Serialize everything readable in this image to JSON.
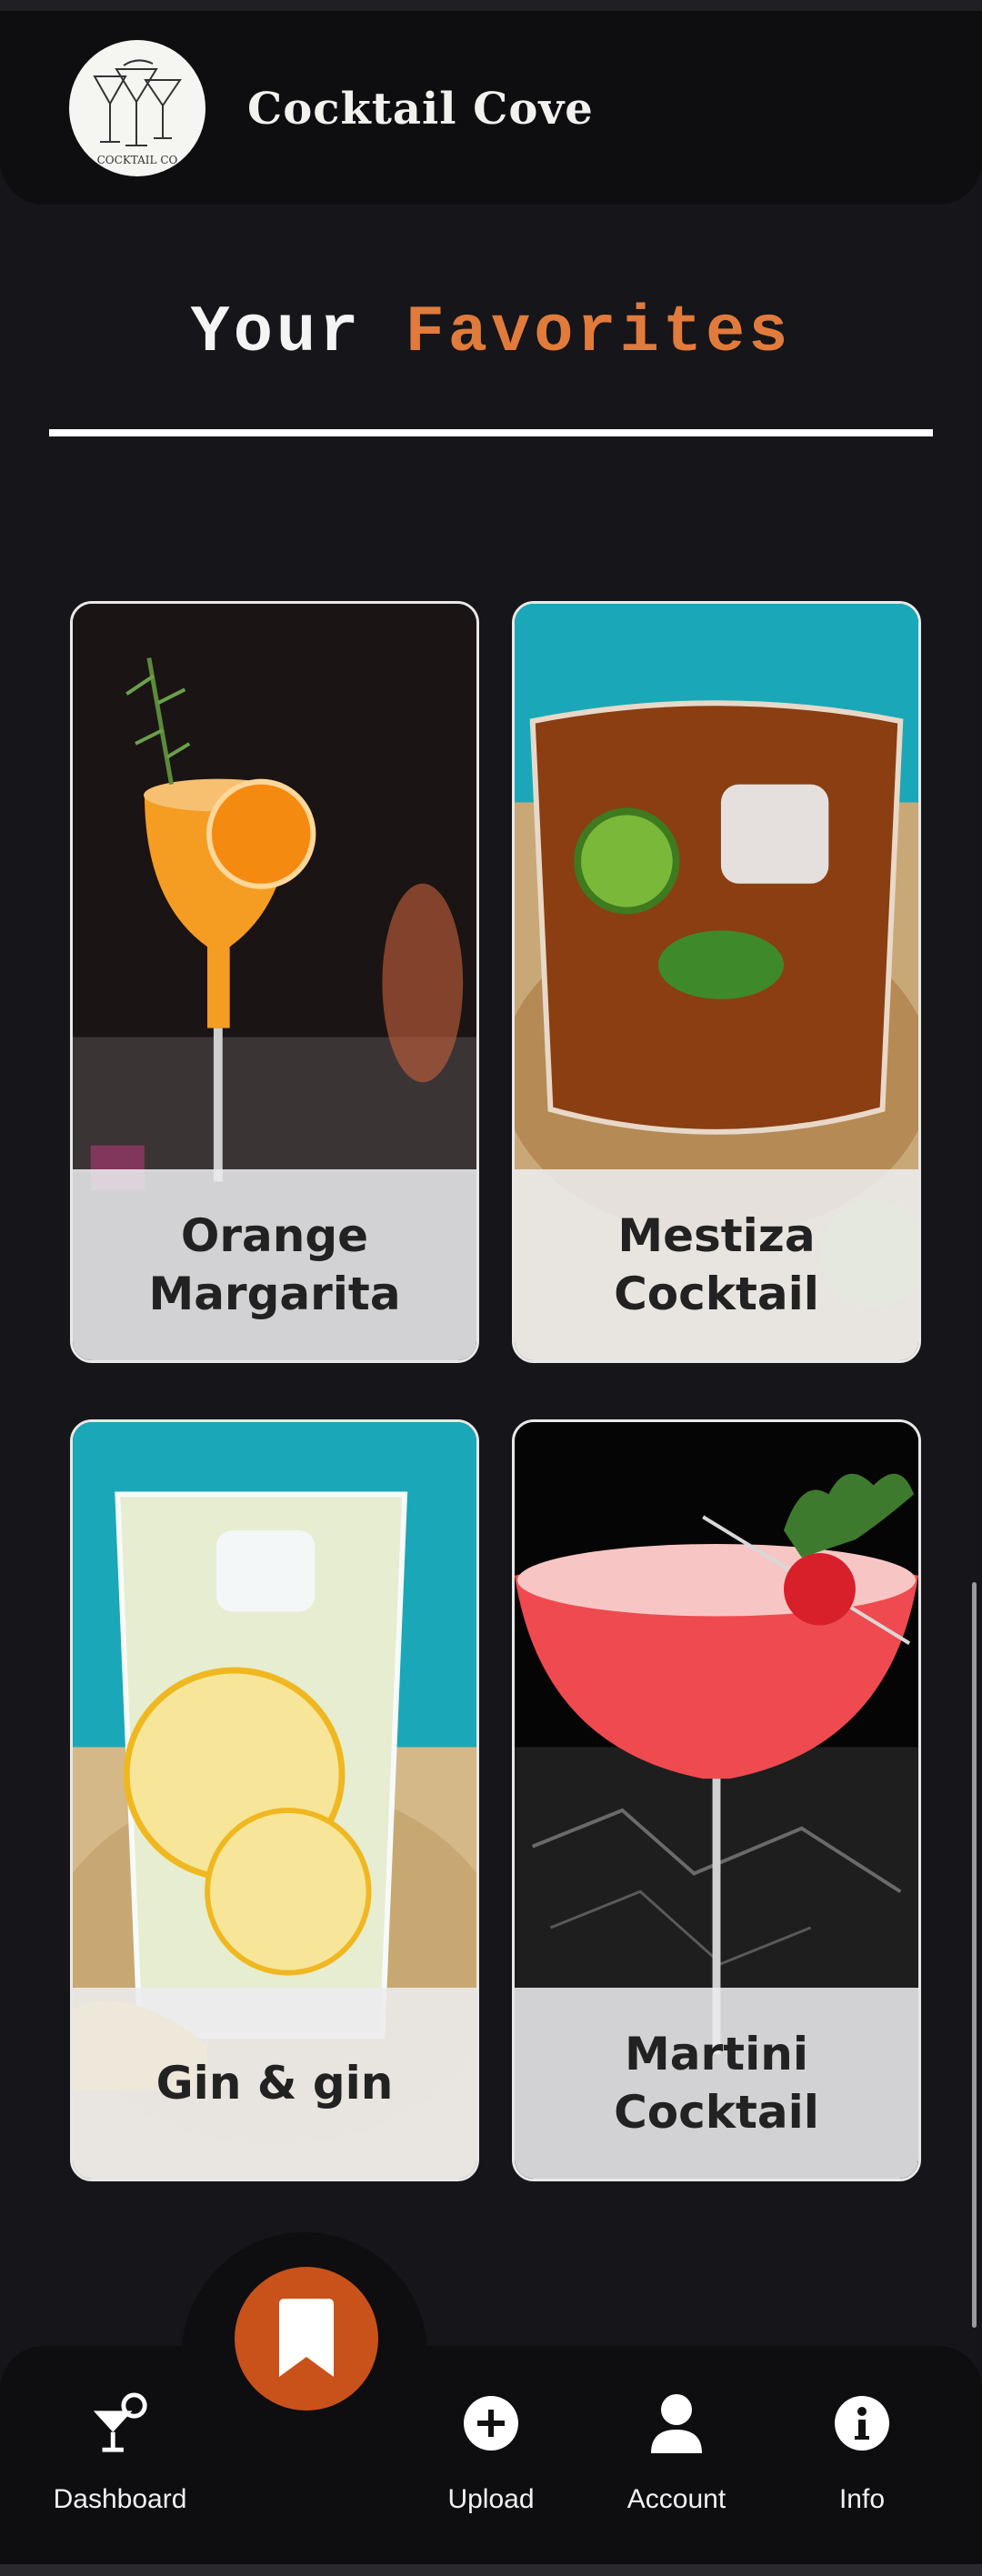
{
  "app": {
    "title": "Cocktail Cove",
    "logo_text": "COCKTAIL CO"
  },
  "heading": {
    "part1": "Your ",
    "part2": "Favorites"
  },
  "favorites": [
    {
      "name": "Orange Margarita"
    },
    {
      "name": "Mestiza Cocktail"
    },
    {
      "name": "Gin & gin"
    },
    {
      "name": "Martini Cocktail"
    }
  ],
  "nav": {
    "dashboard": "Dashboard",
    "upload": "Upload",
    "account": "Account",
    "info": "Info",
    "fab_icon": "bookmark-icon"
  },
  "colors": {
    "accent": "#e07b3c",
    "fab": "#c9521a",
    "background": "#15151a"
  }
}
